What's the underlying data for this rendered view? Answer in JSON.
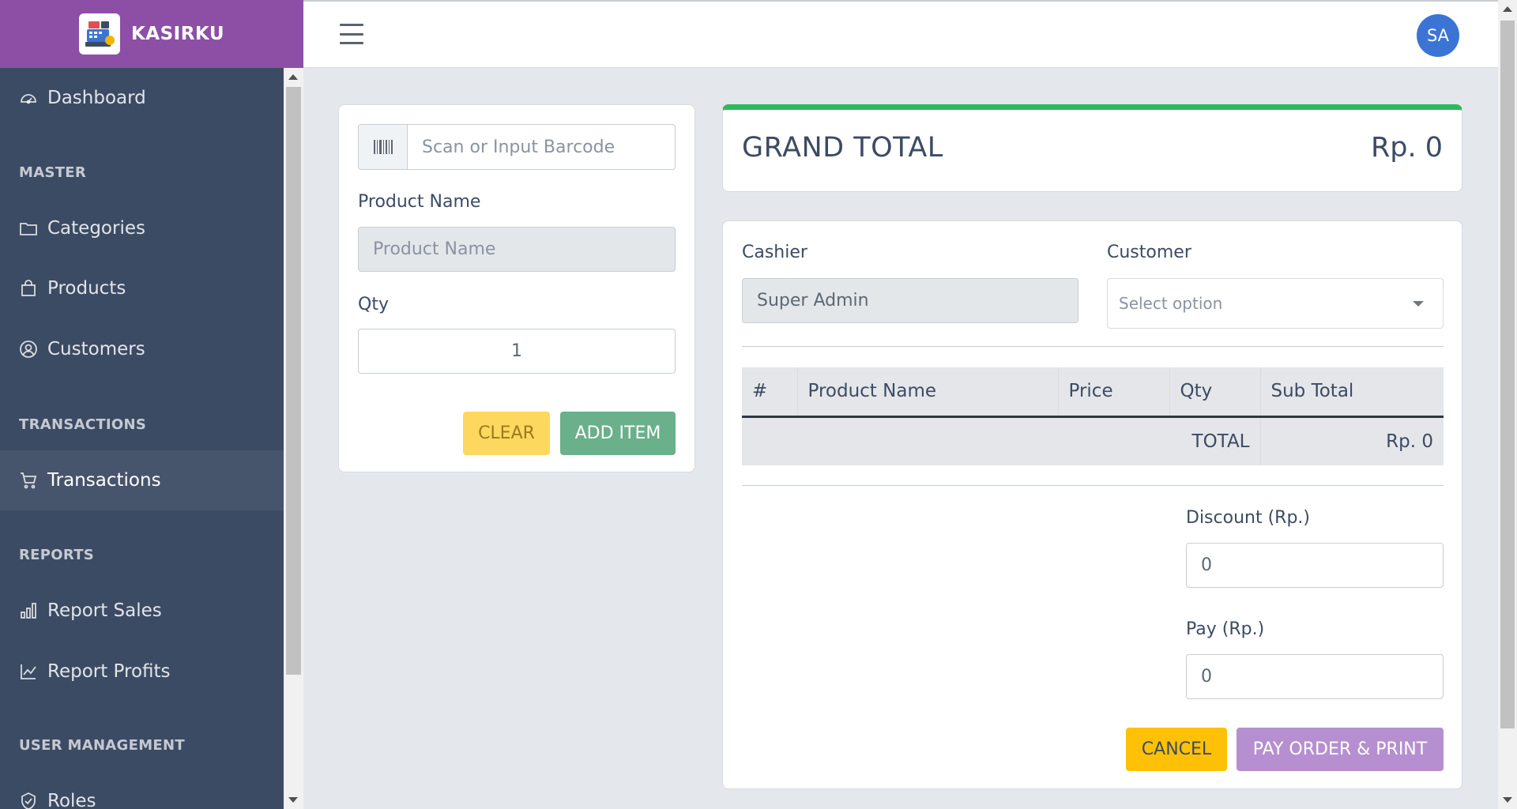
{
  "app": {
    "brand": "KASIRKU"
  },
  "sidebar": {
    "items": [
      {
        "label": "Dashboard",
        "icon": "speedometer-icon"
      },
      {
        "label": "Categories",
        "icon": "folder-icon"
      },
      {
        "label": "Products",
        "icon": "shopping-bag-icon"
      },
      {
        "label": "Customers",
        "icon": "user-circle-icon"
      },
      {
        "label": "Transactions",
        "icon": "cart-icon",
        "active": true
      },
      {
        "label": "Report Sales",
        "icon": "bar-chart-icon"
      },
      {
        "label": "Report Profits",
        "icon": "line-chart-icon"
      },
      {
        "label": "Roles",
        "icon": "shield-check-icon"
      }
    ],
    "sections": {
      "master": "MASTER",
      "transactions": "TRANSACTIONS",
      "reports": "REPORTS",
      "user_management": "USER MANAGEMENT"
    }
  },
  "header": {
    "avatar_initials": "SA",
    "avatar_color": "#3b74d4"
  },
  "entry": {
    "barcode_placeholder": "Scan or Input Barcode",
    "product_name_label": "Product Name",
    "product_name_placeholder": "Product Name",
    "qty_label": "Qty",
    "qty_value": "1",
    "clear_label": "CLEAR",
    "add_item_label": "ADD ITEM"
  },
  "grand_total": {
    "label": "GRAND TOTAL",
    "value": "Rp. 0",
    "accent": "#2eb85c"
  },
  "order": {
    "cashier_label": "Cashier",
    "cashier_value": "Super Admin",
    "customer_label": "Customer",
    "customer_placeholder": "Select option",
    "table": {
      "headers": [
        "#",
        "Product Name",
        "Price",
        "Qty",
        "Sub Total"
      ],
      "total_label": "TOTAL",
      "total_value": "Rp. 0"
    },
    "discount_label": "Discount (Rp.)",
    "discount_value": "0",
    "pay_label": "Pay (Rp.)",
    "pay_value": "0",
    "cancel_label": "CANCEL",
    "pay_button_label": "PAY ORDER & PRINT"
  },
  "colors": {
    "brand": "#8c4fa5",
    "sidebar": "#3c4b64",
    "clear_button": "#fdd85e",
    "add_button": "#6ab08a",
    "cancel_button": "#ffc107",
    "pay_button": "#b68fd0"
  }
}
